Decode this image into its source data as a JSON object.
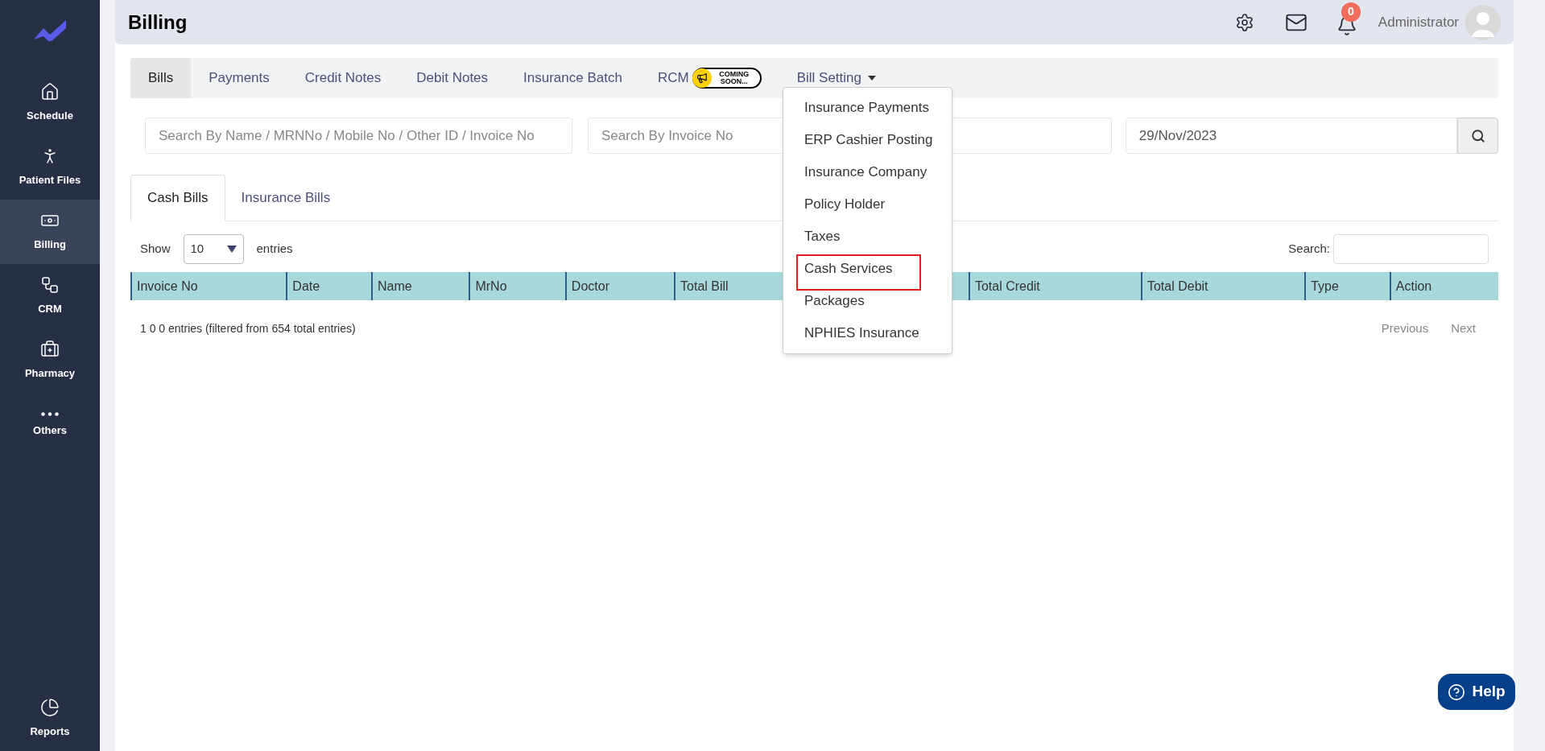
{
  "sidebar": {
    "items": [
      {
        "label": "Schedule",
        "selected": false
      },
      {
        "label": "Patient Files",
        "selected": false
      },
      {
        "label": "Billing",
        "selected": true
      },
      {
        "label": "CRM",
        "selected": false
      },
      {
        "label": "Pharmacy",
        "selected": false
      },
      {
        "label": "Others",
        "selected": false
      }
    ],
    "bottom_item": {
      "label": "Reports",
      "selected": false
    }
  },
  "header": {
    "title": "Billing",
    "notification_count": "0",
    "user": "Administrator"
  },
  "tabs": [
    {
      "label": "Bills",
      "selected": true
    },
    {
      "label": "Payments",
      "selected": false
    },
    {
      "label": "Credit Notes",
      "selected": false
    },
    {
      "label": "Debit Notes",
      "selected": false
    },
    {
      "label": "Insurance Batch",
      "selected": false
    },
    {
      "label": "RCM",
      "selected": false,
      "badge": "COMING SOON..."
    },
    {
      "label": "Bill Setting",
      "selected": false,
      "dropdown": true
    }
  ],
  "dropdown_menu": {
    "items": [
      {
        "label": "Insurance Payments",
        "outlined": false
      },
      {
        "label": "ERP Cashier Posting",
        "outlined": false
      },
      {
        "label": "Insurance Company",
        "outlined": false
      },
      {
        "label": "Policy Holder",
        "outlined": false
      },
      {
        "label": "Taxes",
        "outlined": false
      },
      {
        "label": "Cash Services",
        "outlined": true
      },
      {
        "label": "Packages",
        "outlined": false
      },
      {
        "label": "NPHIES Insurance",
        "outlined": false
      }
    ]
  },
  "filters": {
    "search_placeholder": "Search By Name / MRNNo / Mobile No / Other ID / Invoice No",
    "invoice_placeholder": "Search By Invoice No",
    "date": "29/Nov/2023"
  },
  "sub_tabs": [
    {
      "label": "Cash Bills",
      "selected": true
    },
    {
      "label": "Insurance Bills",
      "selected": false
    }
  ],
  "table": {
    "show_label": "Show",
    "page_size": "10",
    "entries_label": "entries",
    "search_label": "Search:",
    "columns": [
      "Invoice No",
      "Date",
      "Name",
      "MrNo",
      "Doctor",
      "Total Bill",
      "Total Credit",
      "Total Debit",
      "Type",
      "Action"
    ],
    "info": "1 0 0 entries (filtered from 654 total entries)",
    "pagination": [
      {
        "label": "Previous",
        "disabled": true
      },
      {
        "label": "Next",
        "disabled": true
      }
    ]
  },
  "help_button": "Help"
}
